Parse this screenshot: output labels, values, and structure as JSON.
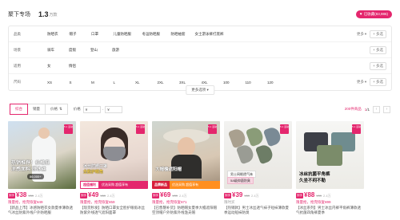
{
  "header": {
    "title": "聚下专场",
    "count": "1.3",
    "unit": "万款",
    "badge": "已收藏(83,986)"
  },
  "filters": [
    {
      "label": "品类",
      "options": [
        "防晒衣",
        "帽子",
        "口罩",
        "儿童防晒服",
        "冬运防晒服",
        "防晒袖套",
        "女士游泳裤打底裤"
      ],
      "more": "更多",
      "multi": "+ 多选"
    },
    {
      "label": "场景",
      "options": [
        "骑车",
        "度假",
        "登山",
        "旅游"
      ],
      "more": "",
      "multi": "+ 多选"
    },
    {
      "label": "适用",
      "options": [
        "女",
        "情侣"
      ],
      "more": "",
      "multi": "+ 多选"
    },
    {
      "label": "尺码",
      "options": [
        "XS",
        "S",
        "M",
        "L",
        "XL",
        "2XL",
        "3XL",
        "4XL",
        "100",
        "110",
        "120"
      ],
      "more": "更多",
      "multi": "+ 多选"
    }
  ],
  "more_options": "更多选项",
  "sortbar": {
    "buttons": [
      "综合",
      "销量",
      "价格"
    ],
    "price_label": "价格",
    "price_min": "¥",
    "price_max": "¥",
    "result_count": "200件商品",
    "page": "1",
    "page_total": "/1"
  },
  "products": [
    {
      "price": "38",
      "old": "¥59",
      "sold": "2.4万",
      "promo": "限量抢，抢完恢复¥49",
      "name": "【新品上市】冰感防晒衣女款夏季薄款透气冰丝防紫外线户外防晒服",
      "ov1": "热销推荐！价格低",
      "ov2": "凉感面料 凉冰丝",
      "pill": "86,000+",
      "band1": "",
      "band2": ""
    },
    {
      "price": "49",
      "old": "¥69",
      "sold": "2.4万",
      "promo": "限量抢，抢完恢复¥59",
      "name": "【现货秒发】防晒口罩女全脸护眼角冰丝防紫外线透气遮阳面罩",
      "ov1": "冰丝防晒口罩",
      "ov2": "全脸护眼角",
      "pill": "",
      "band1": "超值福利",
      "band2": "优选采购 超值享有"
    },
    {
      "price": "69",
      "old": "¥99",
      "sold": "2.4万",
      "promo": "限量抢，抢完恢复¥71",
      "name": "【已售罄补货】防晒帽女夏季大檐遮阳帽空顶帽户外防紫外线渔夫帽",
      "ov1": "大帽檐遮阳帽",
      "ov2": "",
      "pill": "",
      "band1": "品牌新品",
      "band2": "优选采购 超值享有"
    },
    {
      "price": "39",
      "old": "¥69",
      "sold": "2.4万",
      "promo": "限时买",
      "name": "【热销款】男士冰丝透气袜子短袜薄款夏季运动船袜防臭",
      "ov1": "男士网眼透气袜",
      "ov2": "5A级抑菌防臭",
      "pill": "",
      "band1": "",
      "band2": ""
    },
    {
      "price": "88",
      "old": "¥99",
      "sold": "2.4万",
      "promo": "限量抢，抢完恢复¥99",
      "name": "【冰丝系列】男士冰丝内裤平角裤薄款透气抗菌四角裤夏季",
      "ov1": "冰丝抗菌平角裤",
      "ov2": "久坐不闷不勒",
      "pill": "",
      "band1": "",
      "band2": ""
    }
  ],
  "badge_label": "5.1 活动",
  "price_prefix": "到手",
  "colors": {
    "accent": "#e4266d",
    "orange": "#ff8f1f",
    "red": "#d81e3a"
  }
}
